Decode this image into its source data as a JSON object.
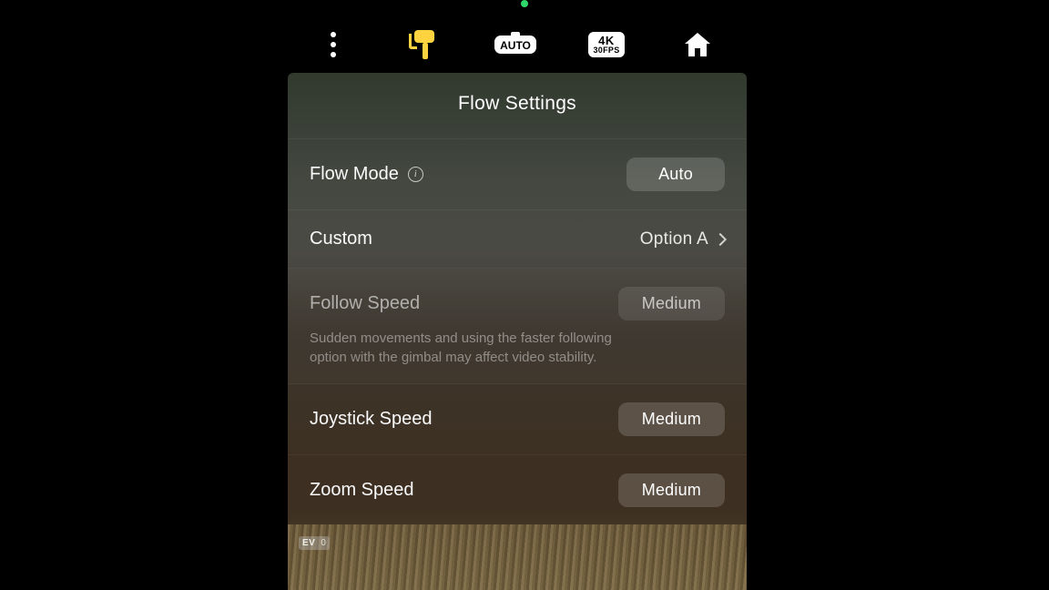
{
  "toolbar": {
    "auto_badge": "AUTO",
    "resolution_line1": "4K",
    "resolution_line2": "30FPS"
  },
  "panel": {
    "title": "Flow Settings",
    "rows": {
      "flow_mode": {
        "label": "Flow Mode",
        "value": "Auto"
      },
      "custom": {
        "label": "Custom",
        "value": "Option A"
      },
      "follow_speed": {
        "label": "Follow Speed",
        "value": "Medium",
        "description": "Sudden movements and using the faster following option with the gimbal may affect video stability."
      },
      "joystick_speed": {
        "label": "Joystick Speed",
        "value": "Medium"
      },
      "zoom_speed": {
        "label": "Zoom Speed",
        "value": "Medium"
      }
    },
    "ev_badge": "EV",
    "ev_value": "0"
  }
}
